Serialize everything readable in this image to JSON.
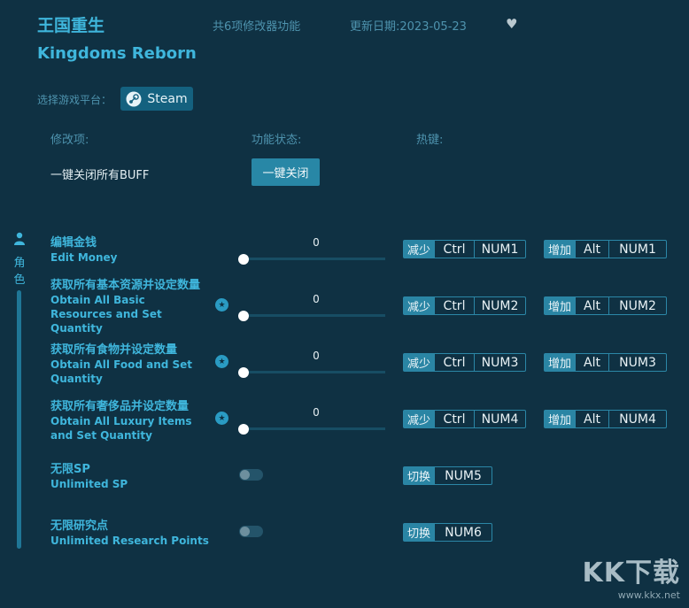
{
  "header": {
    "title_cn": "王国重生",
    "title_en": "Kingdoms Reborn",
    "feature_count": "共6项修改器功能",
    "update_date": "更新日期:2023-05-23"
  },
  "platform": {
    "label": "选择游戏平台：",
    "steam_label": "Steam"
  },
  "columns": {
    "item": "修改项:",
    "status": "功能状态:",
    "hotkey": "热键:"
  },
  "all_buff": {
    "label": "一键关闭所有BUFF",
    "button": "一键关闭"
  },
  "side": {
    "label": "角色"
  },
  "sliders": [
    {
      "cn": "编辑金钱",
      "en": "Edit Money",
      "value": "0",
      "vip": false,
      "dec": {
        "tag": "减少",
        "mod": "Ctrl",
        "key": "NUM1"
      },
      "inc": {
        "tag": "增加",
        "mod": "Alt",
        "key": "NUM1"
      }
    },
    {
      "cn": "获取所有基本资源并设定数量",
      "en": "Obtain All Basic Resources and Set Quantity",
      "value": "0",
      "vip": true,
      "dec": {
        "tag": "减少",
        "mod": "Ctrl",
        "key": "NUM2"
      },
      "inc": {
        "tag": "增加",
        "mod": "Alt",
        "key": "NUM2"
      }
    },
    {
      "cn": "获取所有食物并设定数量",
      "en": "Obtain All Food and Set Quantity",
      "value": "0",
      "vip": true,
      "dec": {
        "tag": "减少",
        "mod": "Ctrl",
        "key": "NUM3"
      },
      "inc": {
        "tag": "增加",
        "mod": "Alt",
        "key": "NUM3"
      }
    },
    {
      "cn": "获取所有奢侈品并设定数量",
      "en": "Obtain All Luxury Items and Set Quantity",
      "value": "0",
      "vip": true,
      "dec": {
        "tag": "减少",
        "mod": "Ctrl",
        "key": "NUM4"
      },
      "inc": {
        "tag": "增加",
        "mod": "Alt",
        "key": "NUM4"
      }
    }
  ],
  "toggles": [
    {
      "cn": "无限SP",
      "en": "Unlimited SP",
      "enabled": false,
      "tag": "切换",
      "key": "NUM5"
    },
    {
      "cn": "无限研究点",
      "en": "Unlimited Research Points",
      "enabled": false,
      "tag": "切换",
      "key": "NUM6"
    }
  ],
  "icons": {
    "favorite": "heart-icon",
    "steam": "steam-icon",
    "side": "character-icon",
    "vip": "star-icon"
  },
  "colors": {
    "background": "#0f3143",
    "accent": "#3fb6dc",
    "button": "#2887a6",
    "tag": "#2a85a4"
  },
  "watermark": {
    "logo": "KK下载",
    "site": "www.kkx.net"
  }
}
